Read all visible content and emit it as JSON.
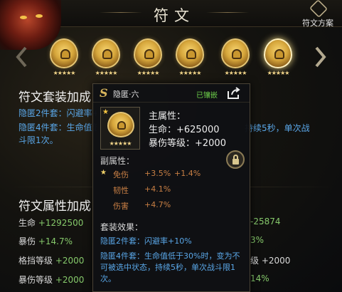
{
  "header": {
    "title": "符文",
    "scheme_label": "符文方案"
  },
  "carousel": {
    "runes": [
      {
        "stars": "★★★★★",
        "selected": false
      },
      {
        "stars": "★★★★★",
        "selected": false
      },
      {
        "stars": "★★★★★",
        "selected": false
      },
      {
        "stars": "★★★★★",
        "selected": false
      },
      {
        "stars": "★★★★★",
        "selected": false
      },
      {
        "stars": "★★★★★",
        "selected": true
      }
    ]
  },
  "set_panel": {
    "heading": "符文套装加成",
    "set2": "隐匿2件套：闪避率+10%",
    "set4": "隐匿4件套：生命值低于30%时，",
    "set4_right": "持续5秒，单次战",
    "set4_line2": "斗限1次。"
  },
  "attr_panel": {
    "heading": "符文属性加成",
    "left": [
      {
        "name": "生命",
        "value": "+1292500"
      },
      {
        "name": "暴伤",
        "value": "+14.7%"
      },
      {
        "name": "格挡等级",
        "value": "+2000"
      },
      {
        "name": "暴伤等级",
        "value": "+2000"
      }
    ],
    "right": [
      {
        "name": "",
        "value": "-25874"
      },
      {
        "name": "",
        "value": "3%"
      },
      {
        "name": "",
        "value": "级 +2000"
      },
      {
        "name": "",
        "value": "14%"
      }
    ]
  },
  "popup": {
    "badge": "S",
    "name": "隐匿·六",
    "status": "已镶嵌",
    "corner_star": "★",
    "rune_stars": "★★★★★",
    "main_label": "主属性：",
    "main_hp": "生命：+625000",
    "main_crit": "暴伤等级：+2000",
    "sub_label": "副属性：",
    "subs": [
      {
        "star": "★",
        "name": "免伤",
        "v1": "+3.5%",
        "v2": "+1.4%"
      },
      {
        "star": "",
        "name": "韧性",
        "v1": "+4.1%",
        "v2": ""
      },
      {
        "star": "",
        "name": "伤害",
        "v1": "+4.7%",
        "v2": ""
      }
    ],
    "set_label": "套装效果：",
    "set2": "隐匿2件套：闪避率+10%",
    "set4": "隐匿4件套：生命值低于30%时，变为不可被选中状态，持续5秒，单次战斗限1次。"
  },
  "colors": {
    "gold": "#d6a63b",
    "blue_text": "#5aa7e8",
    "green_status": "#6dcf4a",
    "orange_sub": "#c87f44"
  }
}
